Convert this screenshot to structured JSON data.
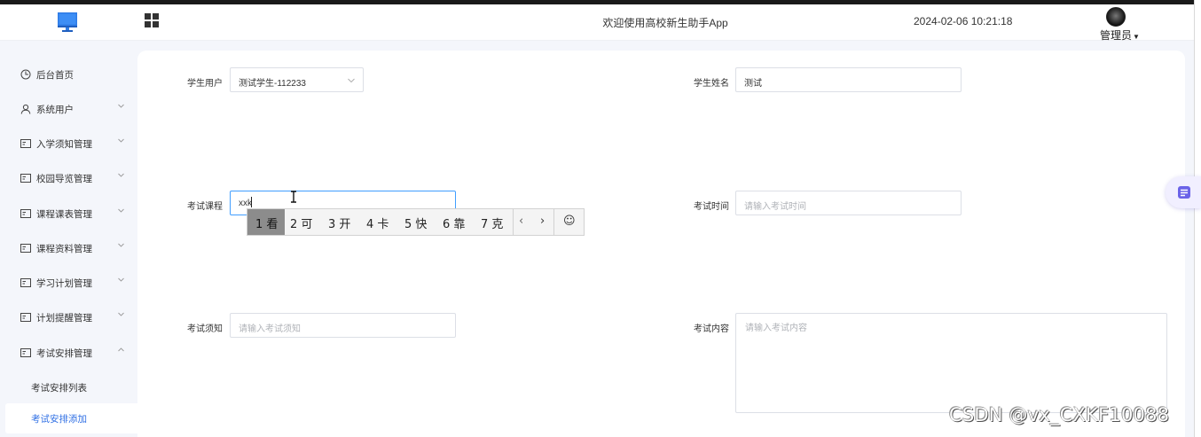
{
  "header": {
    "title": "欢迎使用高校新生助手App",
    "datetime": "2024-02-06 10:21:18",
    "user_label": "管理员",
    "logo_icon": "monitor-icon",
    "menu_icon": "grid-icon",
    "accent": "#2f6fe4"
  },
  "sidebar": {
    "items": [
      {
        "label": "后台首页",
        "icon": "clock-icon"
      },
      {
        "label": "系统用户",
        "icon": "user-icon",
        "arrow": "down"
      },
      {
        "label": "入学须知管理",
        "icon": "card-icon",
        "arrow": "down"
      },
      {
        "label": "校园导览管理",
        "icon": "card-icon",
        "arrow": "down"
      },
      {
        "label": "课程课表管理",
        "icon": "card-icon",
        "arrow": "down"
      },
      {
        "label": "课程资料管理",
        "icon": "card-icon",
        "arrow": "down"
      },
      {
        "label": "学习计划管理",
        "icon": "card-icon",
        "arrow": "down"
      },
      {
        "label": "计划提醒管理",
        "icon": "card-icon",
        "arrow": "down"
      },
      {
        "label": "考试安排管理",
        "icon": "card-icon",
        "arrow": "up"
      }
    ],
    "subitems": [
      {
        "label": "考试安排列表",
        "active": false
      },
      {
        "label": "考试安排添加",
        "active": true
      }
    ]
  },
  "form": {
    "student_user": {
      "label": "学生用户",
      "value": "测试学生-112233"
    },
    "student_name": {
      "label": "学生姓名",
      "value": "测试"
    },
    "exam_course": {
      "label": "考试课程",
      "value": "xxk"
    },
    "exam_time": {
      "label": "考试时间",
      "placeholder": "请输入考试时间"
    },
    "exam_notice": {
      "label": "考试须知",
      "placeholder": "请输入考试须知"
    },
    "exam_content": {
      "label": "考试内容",
      "placeholder": "请输入考试内容"
    }
  },
  "ime": {
    "candidates": [
      "1 看",
      "2 可",
      "3 开",
      "4 卡",
      "5 快",
      "6 靠",
      "7 克"
    ],
    "selected_index": 0,
    "prev": "‹",
    "next": "›",
    "emoji": "☺"
  },
  "watermark": "CSDN @vx_CXKF10088"
}
